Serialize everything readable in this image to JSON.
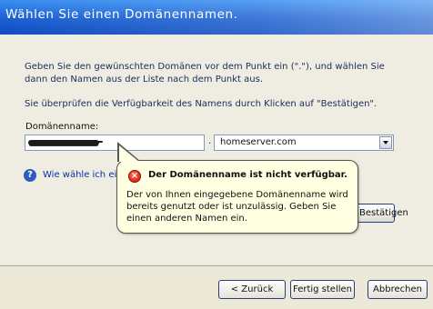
{
  "header": {
    "title": "Wählen Sie einen Domänennamen."
  },
  "main": {
    "intro_line1": "Geben Sie den gewünschten Domänen vor dem Punkt ein (\".\"), und wählen Sie",
    "intro_line2": "dann den Namen aus der Liste nach dem Punkt aus.",
    "verify_text": "Sie überprüfen die Verfügbarkeit des Namens durch Klicken auf \"Bestätigen\".",
    "field_label": "Domänenname:",
    "dot": ".",
    "tld_selected": "homeserver.com",
    "help_link": "Wie wähle ich ein",
    "confirm_button": "Bestätigen"
  },
  "balloon": {
    "title": "Der Domänenname ist nicht verfügbar.",
    "message": "Der von Ihnen eingegebene Domänenname wird bereits genutzt oder ist unzulässig. Geben Sie einen anderen Namen ein."
  },
  "footer": {
    "back": "< Zurück",
    "finish": "Fertig stellen",
    "cancel": "Abbrechen"
  },
  "colors": {
    "header": "#1a5fd0",
    "balloon_bg": "#ffffe1",
    "error": "#d41000",
    "link": "#0a2fa8"
  },
  "icons": {
    "help": "help-icon",
    "error": "error-icon",
    "dropdown": "chevron-down-icon"
  }
}
